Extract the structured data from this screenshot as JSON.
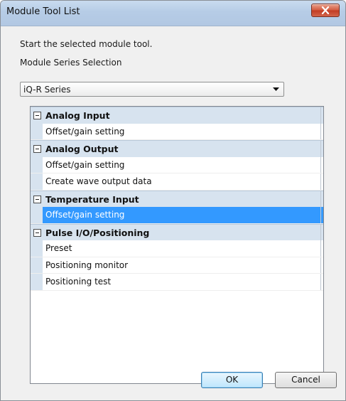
{
  "window": {
    "title": "Module Tool List"
  },
  "dialog": {
    "instruction": "Start the selected module tool.",
    "series_label": "Module Series Selection",
    "series_select": {
      "value": "iQ-R Series"
    }
  },
  "tree": {
    "groups": [
      {
        "label": "Analog Input",
        "items": [
          {
            "label": "Offset/gain setting",
            "selected": false
          }
        ]
      },
      {
        "label": "Analog Output",
        "items": [
          {
            "label": "Offset/gain setting",
            "selected": false
          },
          {
            "label": "Create wave output data",
            "selected": false
          }
        ]
      },
      {
        "label": "Temperature Input",
        "items": [
          {
            "label": "Offset/gain setting",
            "selected": true
          }
        ]
      },
      {
        "label": "Pulse I/O/Positioning",
        "items": [
          {
            "label": "Preset",
            "selected": false
          },
          {
            "label": "Positioning monitor",
            "selected": false
          },
          {
            "label": "Positioning test",
            "selected": false
          }
        ]
      }
    ]
  },
  "buttons": {
    "ok": "OK",
    "cancel": "Cancel"
  },
  "colors": {
    "selection": "#3399ff",
    "group_bg": "#d7e3ef",
    "close": "#c13b22"
  }
}
